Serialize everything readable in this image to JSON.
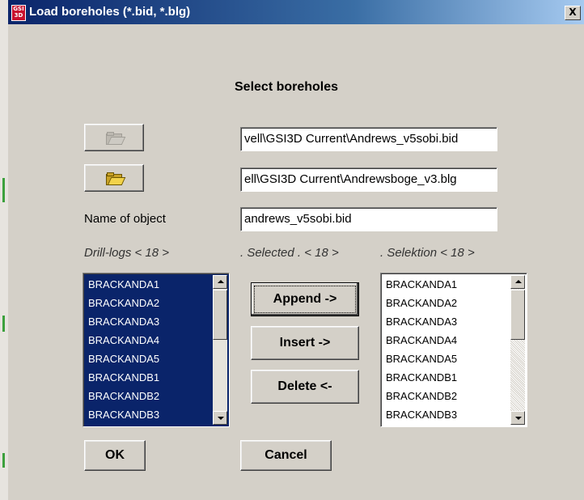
{
  "window": {
    "title": "Load boreholes (*.bid, *.blg)",
    "app_icon": "GSI\n3D",
    "close_label": "X"
  },
  "heading": "Select boreholes",
  "file_rows": {
    "bid_path": "vell\\GSI3D Current\\Andrews_v5sobi.bid",
    "blg_path": "ell\\GSI3D Current\\Andrewsboge_v3.blg"
  },
  "object_name": {
    "label": "Name of object",
    "value": "andrews_v5sobi.bid"
  },
  "lists": {
    "drill_logs_label": "Drill-logs < 18 >",
    "selected_label": ". Selected . < 18 >",
    "selektion_label": ".   Selektion < 18 >",
    "drill_logs": [
      "BRACKANDA1",
      "BRACKANDA2",
      "BRACKANDA3",
      "BRACKANDA4",
      "BRACKANDA5",
      "BRACKANDB1",
      "BRACKANDB2",
      "BRACKANDB3"
    ],
    "selektion": [
      "BRACKANDA1",
      "BRACKANDA2",
      "BRACKANDA3",
      "BRACKANDA4",
      "BRACKANDA5",
      "BRACKANDB1",
      "BRACKANDB2",
      "BRACKANDB3"
    ]
  },
  "buttons": {
    "append": "Append  ->",
    "insert": "Insert    ->",
    "delete": "Delete   <-",
    "ok": "OK",
    "cancel": "Cancel"
  },
  "icons": {
    "close": "close-icon",
    "browse_bid": "open-folder-icon",
    "browse_blg": "open-folder-icon"
  }
}
